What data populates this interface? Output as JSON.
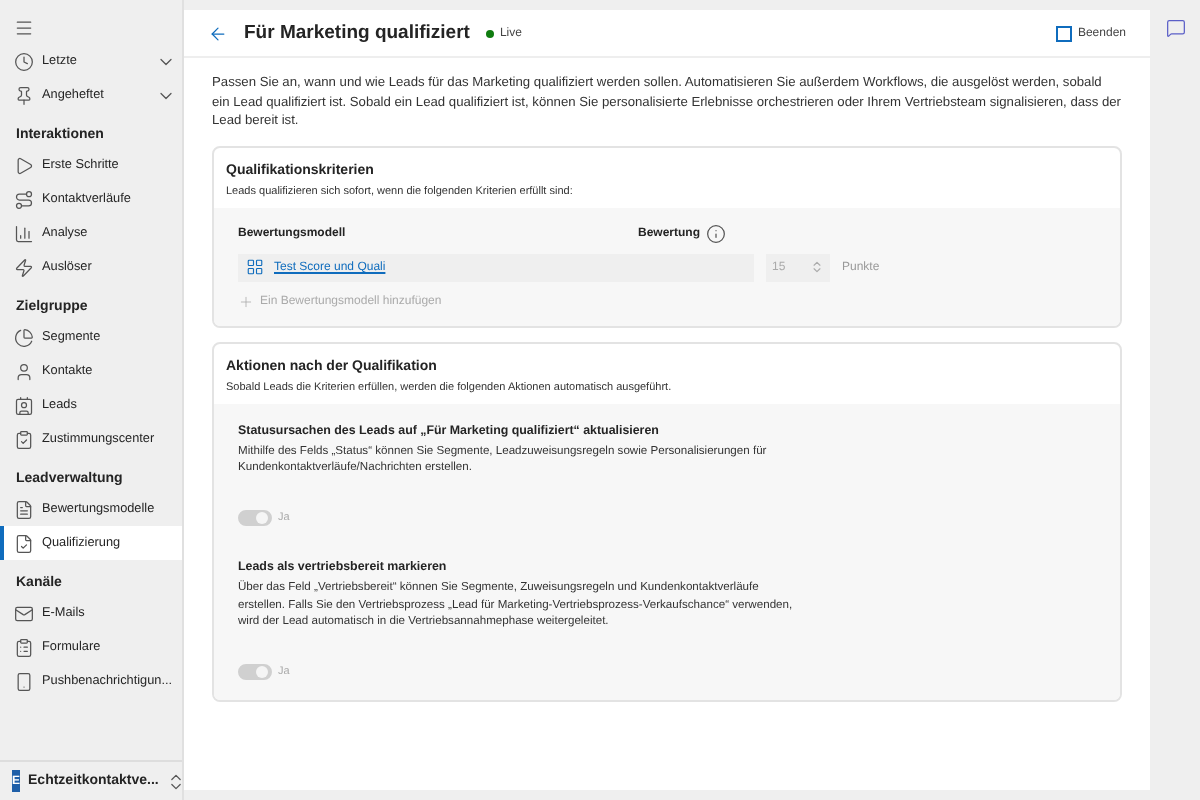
{
  "sidebar": {
    "top_items": [
      {
        "label": "Letzte",
        "expanded": false
      },
      {
        "label": "Angeheftet",
        "expanded": false
      }
    ],
    "sections": [
      {
        "heading": "Interaktionen",
        "items": [
          {
            "label": "Erste Schritte",
            "selected": false
          },
          {
            "label": "Kontaktverläufe",
            "selected": false
          },
          {
            "label": "Analyse",
            "selected": false
          },
          {
            "label": "Auslöser",
            "selected": false
          }
        ]
      },
      {
        "heading": "Zielgruppe",
        "items": [
          {
            "label": "Segmente",
            "selected": false
          },
          {
            "label": "Kontakte",
            "selected": false
          },
          {
            "label": "Leads",
            "selected": false
          },
          {
            "label": "Zustimmungscenter",
            "selected": false
          }
        ]
      },
      {
        "heading": "Leadverwaltung",
        "items": [
          {
            "label": "Bewertungsmodelle",
            "selected": false
          },
          {
            "label": "Qualifizierung",
            "selected": true
          }
        ]
      },
      {
        "heading": "Kanäle",
        "items": [
          {
            "label": "E-Mails",
            "selected": false
          },
          {
            "label": "Formulare",
            "selected": false
          },
          {
            "label": "Pushbenachrichtigun...",
            "selected": false
          }
        ]
      }
    ],
    "area": {
      "badge": "E",
      "label": "Echtzeitkontaktve..."
    }
  },
  "header": {
    "title": "Für Marketing qualifiziert",
    "status": {
      "label": "Live",
      "color": "#107c10"
    },
    "end_label": "Beenden",
    "end_checked": false
  },
  "description": "Passen Sie an, wann und wie Leads für das Marketing qualifiziert werden sollen. Automatisieren Sie außerdem Workflows, die ausgelöst werden, sobald ein Lead qualifiziert ist. Sobald ein Lead qualifiziert ist, können Sie personalisierte Erlebnisse orchestrieren oder Ihrem Vertriebsteam signalisieren, dass der Lead bereit ist.",
  "criteria": {
    "title": "Qualifikationskriterien",
    "subtitle": "Leads qualifizieren sich sofort, wenn die folgenden Kriterien erfüllt sind:",
    "columns": [
      "Bewertungsmodell",
      "Bewertung"
    ],
    "rows": [
      {
        "model": "Test Score und Quali",
        "score": "15",
        "unit": "Punkte"
      }
    ],
    "add_label": "Ein Bewertungsmodell hinzufügen"
  },
  "actions": {
    "title": "Aktionen nach der Qualifikation",
    "subtitle": "Sobald Leads die Kriterien erfüllen, werden die folgenden Aktionen automatisch ausgeführt.",
    "items": [
      {
        "title": "Statusursachen des Leads auf „Für Marketing qualifiziert“ aktualisieren",
        "text": "Mithilfe des Felds „Status“ können Sie Segmente, Leadzuweisungsregeln sowie Personalisierungen für Kundenkontaktverläufe/Nachrichten erstellen.",
        "toggle_label": "Ja",
        "on": true,
        "disabled": true
      },
      {
        "title": "Leads als vertriebsbereit markieren",
        "text": "Über das Feld „Vertriebsbereit“ können Sie Segmente, Zuweisungsregeln und Kundenkontaktverläufe erstellen. Falls Sie den Vertriebsprozess „Lead für Marketing-Vertriebsprozess-Verkaufschance“ verwenden, wird der Lead automatisch in die Vertriebsannahmephase weitergeleitet.",
        "toggle_label": "Ja",
        "on": true,
        "disabled": true
      }
    ]
  }
}
